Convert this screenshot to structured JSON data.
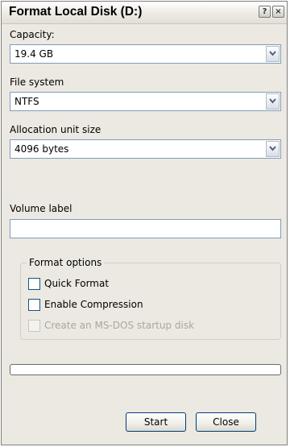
{
  "window": {
    "title": "Format Local Disk (D:)",
    "help_glyph": "?",
    "close_glyph": "×"
  },
  "capacity": {
    "label": "Capacity:",
    "value": "19.4 GB"
  },
  "file_system": {
    "label": "File system",
    "value": "NTFS"
  },
  "allocation": {
    "label": "Allocation unit size",
    "value": "4096 bytes"
  },
  "volume": {
    "label": "Volume label",
    "value": ""
  },
  "format_options": {
    "legend": "Format options",
    "quick_format": {
      "label": "Quick Format",
      "checked": false,
      "enabled": true
    },
    "enable_compression": {
      "label": "Enable Compression",
      "checked": false,
      "enabled": true
    },
    "msdos_startup": {
      "label": "Create an MS-DOS startup disk",
      "checked": false,
      "enabled": false
    }
  },
  "progress": {
    "value": 0
  },
  "buttons": {
    "start": "Start",
    "close": "Close"
  },
  "icons": {
    "dropdown": "chevron-down-icon",
    "help": "help-icon",
    "close": "close-icon"
  },
  "colors": {
    "border_accent": "#7f9db9",
    "button_border": "#003c74",
    "window_bg": "#ebe9e2"
  }
}
